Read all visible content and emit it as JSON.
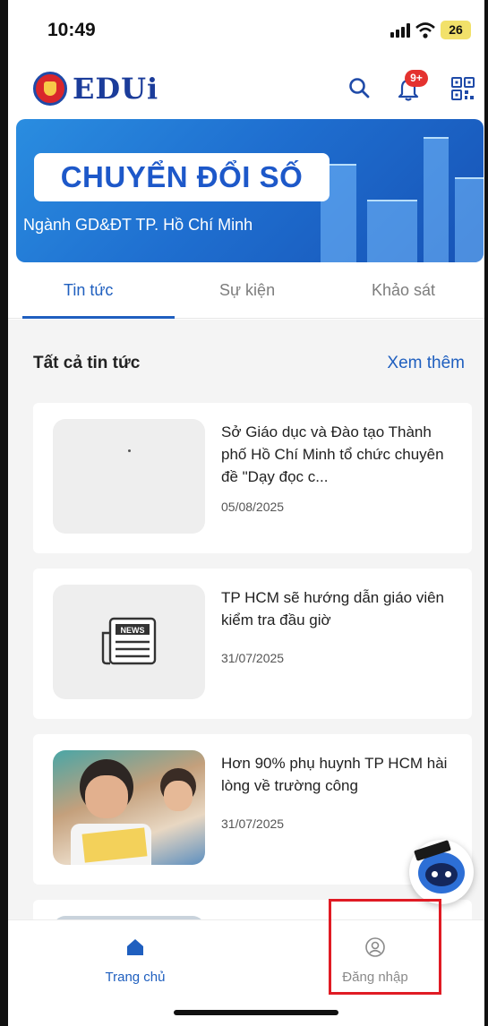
{
  "status_bar": {
    "time": "10:49",
    "battery": "26"
  },
  "header": {
    "app_name": "EDUi",
    "notification_badge": "9+"
  },
  "banner": {
    "title": "CHUYỂN ĐỔI SỐ",
    "subtitle": "Ngành GD&ĐT TP. Hồ Chí Minh"
  },
  "tabs": [
    {
      "label": "Tin tức",
      "active": true
    },
    {
      "label": "Sự kiện",
      "active": false
    },
    {
      "label": "Khảo sát",
      "active": false
    }
  ],
  "section": {
    "title": "Tất cả tin tức",
    "more_label": "Xem thêm"
  },
  "news": [
    {
      "title": "Sở Giáo dục và Đào tạo Thành phố Hồ Chí Minh tổ chức chuyên đề \"Dạy đọc c...",
      "date": "05/08/2025",
      "thumb": "placeholder"
    },
    {
      "title": "TP HCM sẽ hướng dẫn giáo viên kiểm tra đầu giờ",
      "date": "31/07/2025",
      "thumb": "news-icon"
    },
    {
      "title": "Hơn 90% phụ huynh TP HCM hài lòng về trường công",
      "date": "31/07/2025",
      "thumb": "students-photo"
    }
  ],
  "icons": {
    "search": "search-icon",
    "notifications": "bell-icon",
    "qr": "qr-code-icon",
    "home": "home-icon",
    "user": "user-icon",
    "assistant": "chatbot-icon"
  },
  "bottom_nav": [
    {
      "label": "Trang chủ",
      "active": true
    },
    {
      "label": "Đăng nhập",
      "active": false
    }
  ],
  "colors": {
    "primary": "#1f5fbf",
    "brand": "#1b3c9a",
    "badge": "#e4322f",
    "highlight_box": "#e01b24"
  }
}
